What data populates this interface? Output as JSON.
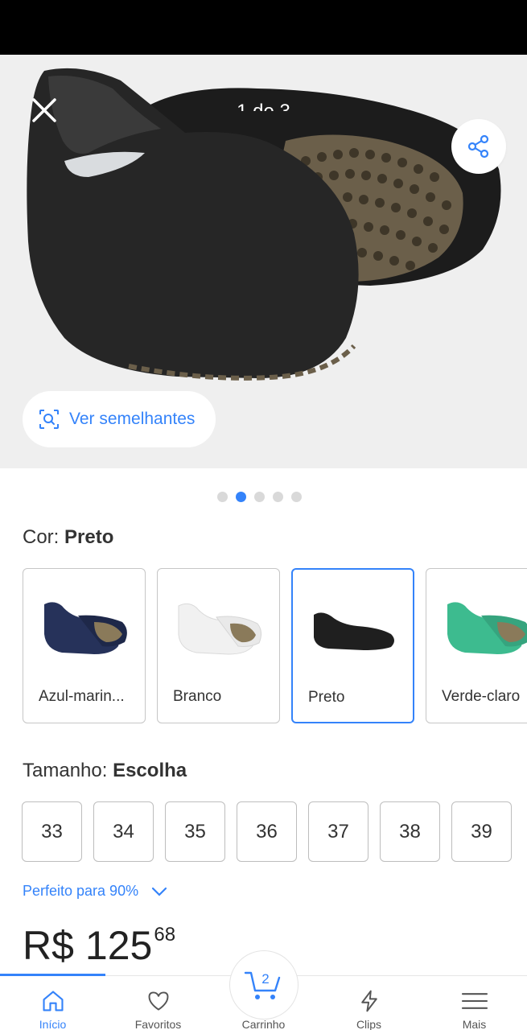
{
  "header": {
    "counter": "1 de 3"
  },
  "gallery": {
    "similar_label": "Ver semelhantes",
    "active_dot": 1,
    "dot_count": 5
  },
  "variants": {
    "color_label": "Cor:",
    "color_value": "Preto",
    "colors": [
      {
        "name": "Azul-marin...",
        "color": "#26325a",
        "selected": false
      },
      {
        "name": "Branco",
        "color": "#f3f3f3",
        "selected": false
      },
      {
        "name": "Preto",
        "color": "#222222",
        "selected": true
      },
      {
        "name": "Verde-claro",
        "color": "#3dbb8f",
        "selected": false
      }
    ],
    "size_label": "Tamanho:",
    "size_value": "Escolha",
    "sizes": [
      "33",
      "34",
      "35",
      "36",
      "37",
      "38",
      "39"
    ],
    "fit_text": "Perfeito para 90%"
  },
  "price": {
    "currency": "R$",
    "integer": "125",
    "cents": "68"
  },
  "tabbar": {
    "items": [
      {
        "label": "Início",
        "icon": "home-icon",
        "active": true
      },
      {
        "label": "Favoritos",
        "icon": "heart-icon",
        "active": false
      },
      {
        "label": "Carrinho",
        "icon": "cart-icon",
        "active": false
      },
      {
        "label": "Clips",
        "icon": "lightning-icon",
        "active": false
      },
      {
        "label": "Mais",
        "icon": "menu-icon",
        "active": false
      }
    ],
    "cart_count": "2",
    "accent": "#3483fa"
  }
}
